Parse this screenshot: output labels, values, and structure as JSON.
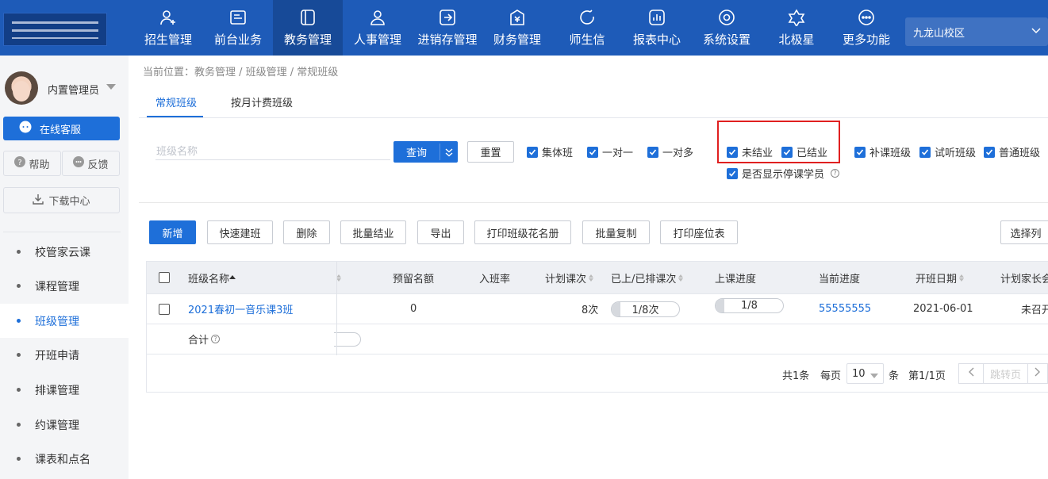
{
  "nav": {
    "items": [
      {
        "label": "招生管理",
        "icon": "user-plus-icon"
      },
      {
        "label": "前台业务",
        "icon": "monitor-icon"
      },
      {
        "label": "教务管理",
        "icon": "book-icon"
      },
      {
        "label": "人事管理",
        "icon": "person-icon"
      },
      {
        "label": "进销存管理",
        "icon": "inventory-icon"
      },
      {
        "label": "财务管理",
        "icon": "finance-icon"
      },
      {
        "label": "师生信",
        "icon": "chat-icon"
      },
      {
        "label": "报表中心",
        "icon": "report-icon"
      },
      {
        "label": "系统设置",
        "icon": "settings-icon"
      },
      {
        "label": "北极星",
        "icon": "star-icon"
      },
      {
        "label": "更多功能",
        "icon": "more-icon"
      }
    ],
    "active_index": 2,
    "campus": "九龙山校区"
  },
  "sidebar": {
    "user_name": "内置管理员",
    "service_label": "在线客服",
    "help_label": "帮助",
    "feedback_label": "反馈",
    "download_label": "下载中心",
    "menu": [
      "校管家云课",
      "课程管理",
      "班级管理",
      "开班申请",
      "排课管理",
      "约课管理",
      "课表和点名"
    ],
    "active_menu": 2
  },
  "breadcrumb": "当前位置：教务管理 / 班级管理 / 常规班级",
  "tabs": [
    "常规班级",
    "按月计费班级"
  ],
  "filters": {
    "search_placeholder": "班级名称",
    "query_label": "查询",
    "reset_label": "重置",
    "class_types": [
      "集体班",
      "一对一",
      "一对多"
    ],
    "status": [
      "未结业",
      "已结业"
    ],
    "kinds": [
      "补课班级",
      "试听班级",
      "普通班级"
    ],
    "show_suspended": "是否显示停课学员"
  },
  "toolbar": {
    "add": "新增",
    "quick": "快速建班",
    "delete": "删除",
    "batch_finish": "批量结业",
    "export": "导出",
    "print_roster": "打印班级花名册",
    "batch_copy": "批量复制",
    "print_seats": "打印座位表",
    "choose_cols": "选择列"
  },
  "table": {
    "headers": {
      "name": "班级名称",
      "reserved": "预留名额",
      "enroll_rate": "入班率",
      "planned": "计划课次",
      "done_scheduled": "已上/已排课次",
      "progress": "上课进度",
      "current": "当前进度",
      "start_date": "开班日期",
      "parent_meeting": "计划家长会"
    },
    "rows": [
      {
        "name": "2021春初一音乐课3班",
        "reserved": "0",
        "enroll_rate": "",
        "planned": "8次",
        "done_scheduled": "1/8次",
        "done_fraction": 0.125,
        "progress": "1/8",
        "progress_fraction": 0.125,
        "current": "55555555",
        "start_date": "2021-06-01",
        "parent_meeting": "未召开"
      }
    ],
    "total_label": "合计"
  },
  "pagination": {
    "total": "共1条",
    "per_page_label": "每页",
    "page_size": "10",
    "unit": "条",
    "page_info": "第1/1页",
    "jump": "跳转页"
  },
  "colors": {
    "primary": "#1e6fd9",
    "topbar": "#1e5bb8",
    "highlight": "#e02020"
  }
}
